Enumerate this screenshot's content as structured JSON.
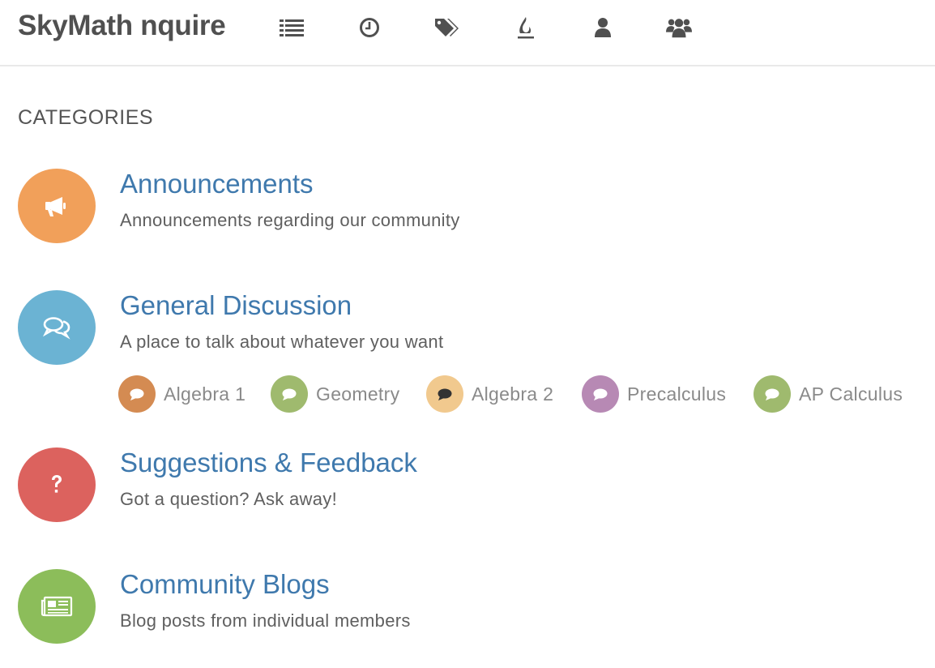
{
  "header": {
    "brand": "SkyMath nquire",
    "nav_icons": [
      "list-icon",
      "clock-icon",
      "tags-icon",
      "fire-icon",
      "user-icon",
      "users-icon"
    ]
  },
  "main": {
    "section_title": "CATEGORIES",
    "categories": [
      {
        "title": "Announcements",
        "description": "Announcements regarding our community",
        "icon": "bullhorn-icon",
        "color": "#f1a05a"
      },
      {
        "title": "General Discussion",
        "description": "A place to talk about whatever you want",
        "icon": "comments-icon",
        "color": "#6bb3d3",
        "subcategories": [
          {
            "label": "Algebra 1",
            "icon": "comment-icon",
            "color": "#d48b52"
          },
          {
            "label": "Geometry",
            "icon": "comment-icon",
            "color": "#9fba6e"
          },
          {
            "label": "Algebra 2",
            "icon": "comment-icon",
            "color": "#f1c98e"
          },
          {
            "label": "Precalculus",
            "icon": "comment-icon",
            "color": "#b789b4"
          },
          {
            "label": "AP Calculus",
            "icon": "comment-icon",
            "color": "#9fba6e"
          }
        ]
      },
      {
        "title": "Suggestions & Feedback",
        "description": "Got a question? Ask away!",
        "icon": "question-icon",
        "color": "#dc625e"
      },
      {
        "title": "Community Blogs",
        "description": "Blog posts from individual members",
        "icon": "newspaper-icon",
        "color": "#8cbd5a"
      }
    ]
  }
}
